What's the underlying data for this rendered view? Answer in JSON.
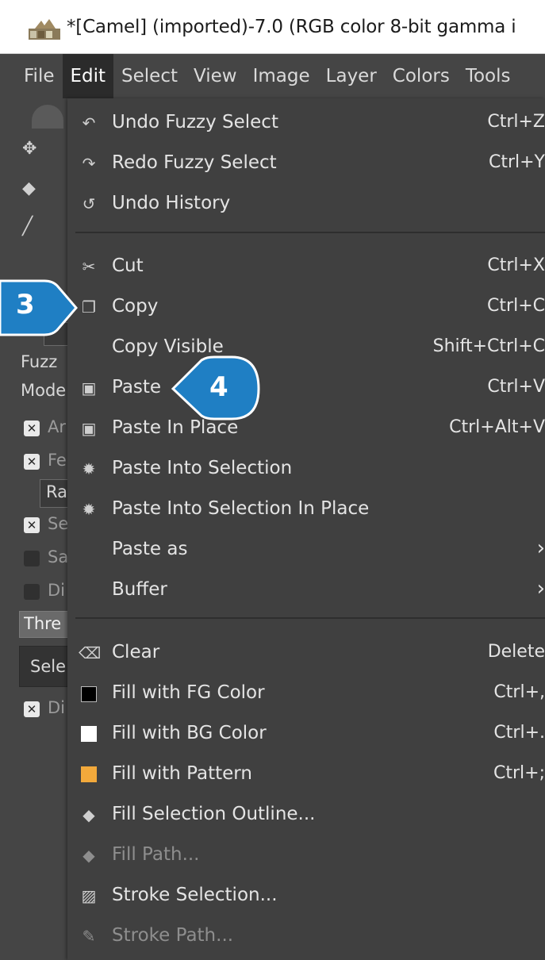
{
  "window": {
    "title": "*[Camel] (imported)-7.0 (RGB color 8-bit gamma i"
  },
  "menubar": {
    "items": [
      {
        "label": "File"
      },
      {
        "label": "Edit"
      },
      {
        "label": "Select"
      },
      {
        "label": "View"
      },
      {
        "label": "Image"
      },
      {
        "label": "Layer"
      },
      {
        "label": "Colors"
      },
      {
        "label": "Tools"
      }
    ],
    "active": "Edit"
  },
  "toolbox": {
    "tool_options_title": "Fuzz",
    "mode_label": "Mode",
    "options": [
      {
        "label": "Ar",
        "checked": true
      },
      {
        "label": "Fe",
        "checked": true
      },
      {
        "label": "Ra",
        "checked": null
      },
      {
        "label": "Se",
        "checked": true
      },
      {
        "label": "Sa",
        "checked": false
      },
      {
        "label": "Di",
        "checked": false
      }
    ],
    "threshold_label": "Thre",
    "select_label": "Sele",
    "draw_mask_label": "Di",
    "draw_mask_checked": true
  },
  "edit_menu": {
    "items": [
      {
        "icon": "undo-icon",
        "glyph": "↶",
        "label": "Undo Fuzzy Select",
        "shortcut": "Ctrl+Z",
        "enabled": true
      },
      {
        "icon": "redo-icon",
        "glyph": "↷",
        "label": "Redo Fuzzy Select",
        "shortcut": "Ctrl+Y",
        "enabled": true
      },
      {
        "icon": "history-icon",
        "glyph": "↺",
        "label": "Undo History",
        "shortcut": "",
        "enabled": true
      },
      {
        "icon": "scissors-icon",
        "glyph": "✂",
        "label": "Cut",
        "shortcut": "Ctrl+X",
        "enabled": true
      },
      {
        "icon": "copy-icon",
        "glyph": "❐",
        "label": "Copy",
        "shortcut": "Ctrl+C",
        "enabled": true
      },
      {
        "icon": "",
        "glyph": "",
        "label": "Copy Visible",
        "shortcut": "Shift+Ctrl+C",
        "enabled": true
      },
      {
        "icon": "paste-icon",
        "glyph": "▣",
        "label": "Paste",
        "shortcut": "Ctrl+V",
        "enabled": true
      },
      {
        "icon": "paste-in-place-icon",
        "glyph": "▣",
        "label": "Paste In Place",
        "shortcut": "Ctrl+Alt+V",
        "enabled": true
      },
      {
        "icon": "paste-into-icon",
        "glyph": "✹",
        "label": "Paste Into Selection",
        "shortcut": "",
        "enabled": true
      },
      {
        "icon": "paste-into-in-place-icon",
        "glyph": "✹",
        "label": "Paste Into Selection In Place",
        "shortcut": "",
        "enabled": true
      },
      {
        "icon": "",
        "glyph": "",
        "label": "Paste as",
        "shortcut": "›",
        "enabled": true
      },
      {
        "icon": "",
        "glyph": "",
        "label": "Buffer",
        "shortcut": "›",
        "enabled": true
      },
      {
        "icon": "clear-icon",
        "glyph": "⌫",
        "label": "Clear",
        "shortcut": "Delete",
        "enabled": true
      },
      {
        "icon": "fg-color-swatch-icon",
        "glyph": "",
        "label": "Fill with FG Color",
        "shortcut": "Ctrl+,",
        "enabled": true
      },
      {
        "icon": "bg-color-swatch-icon",
        "glyph": "",
        "label": "Fill with BG Color",
        "shortcut": "Ctrl+.",
        "enabled": true
      },
      {
        "icon": "pattern-swatch-icon",
        "glyph": "",
        "label": "Fill with Pattern",
        "shortcut": "Ctrl+;",
        "enabled": true
      },
      {
        "icon": "fill-outline-icon",
        "glyph": "◆",
        "label": "Fill Selection Outline...",
        "shortcut": "",
        "enabled": true
      },
      {
        "icon": "fill-path-icon",
        "glyph": "◆",
        "label": "Fill Path...",
        "shortcut": "",
        "enabled": false
      },
      {
        "icon": "stroke-selection-icon",
        "glyph": "▨",
        "label": "Stroke Selection...",
        "shortcut": "",
        "enabled": true
      },
      {
        "icon": "stroke-path-icon",
        "glyph": "✎",
        "label": "Stroke Path...",
        "shortcut": "",
        "enabled": false
      }
    ]
  },
  "colors": {
    "fg_color": "#000000",
    "bg_color": "#ffffff",
    "pattern_color": "#f2a93b",
    "callout_color": "#1f7fc4"
  },
  "callouts": [
    {
      "number": "3",
      "target": "Copy"
    },
    {
      "number": "4",
      "target": "Paste"
    }
  ]
}
